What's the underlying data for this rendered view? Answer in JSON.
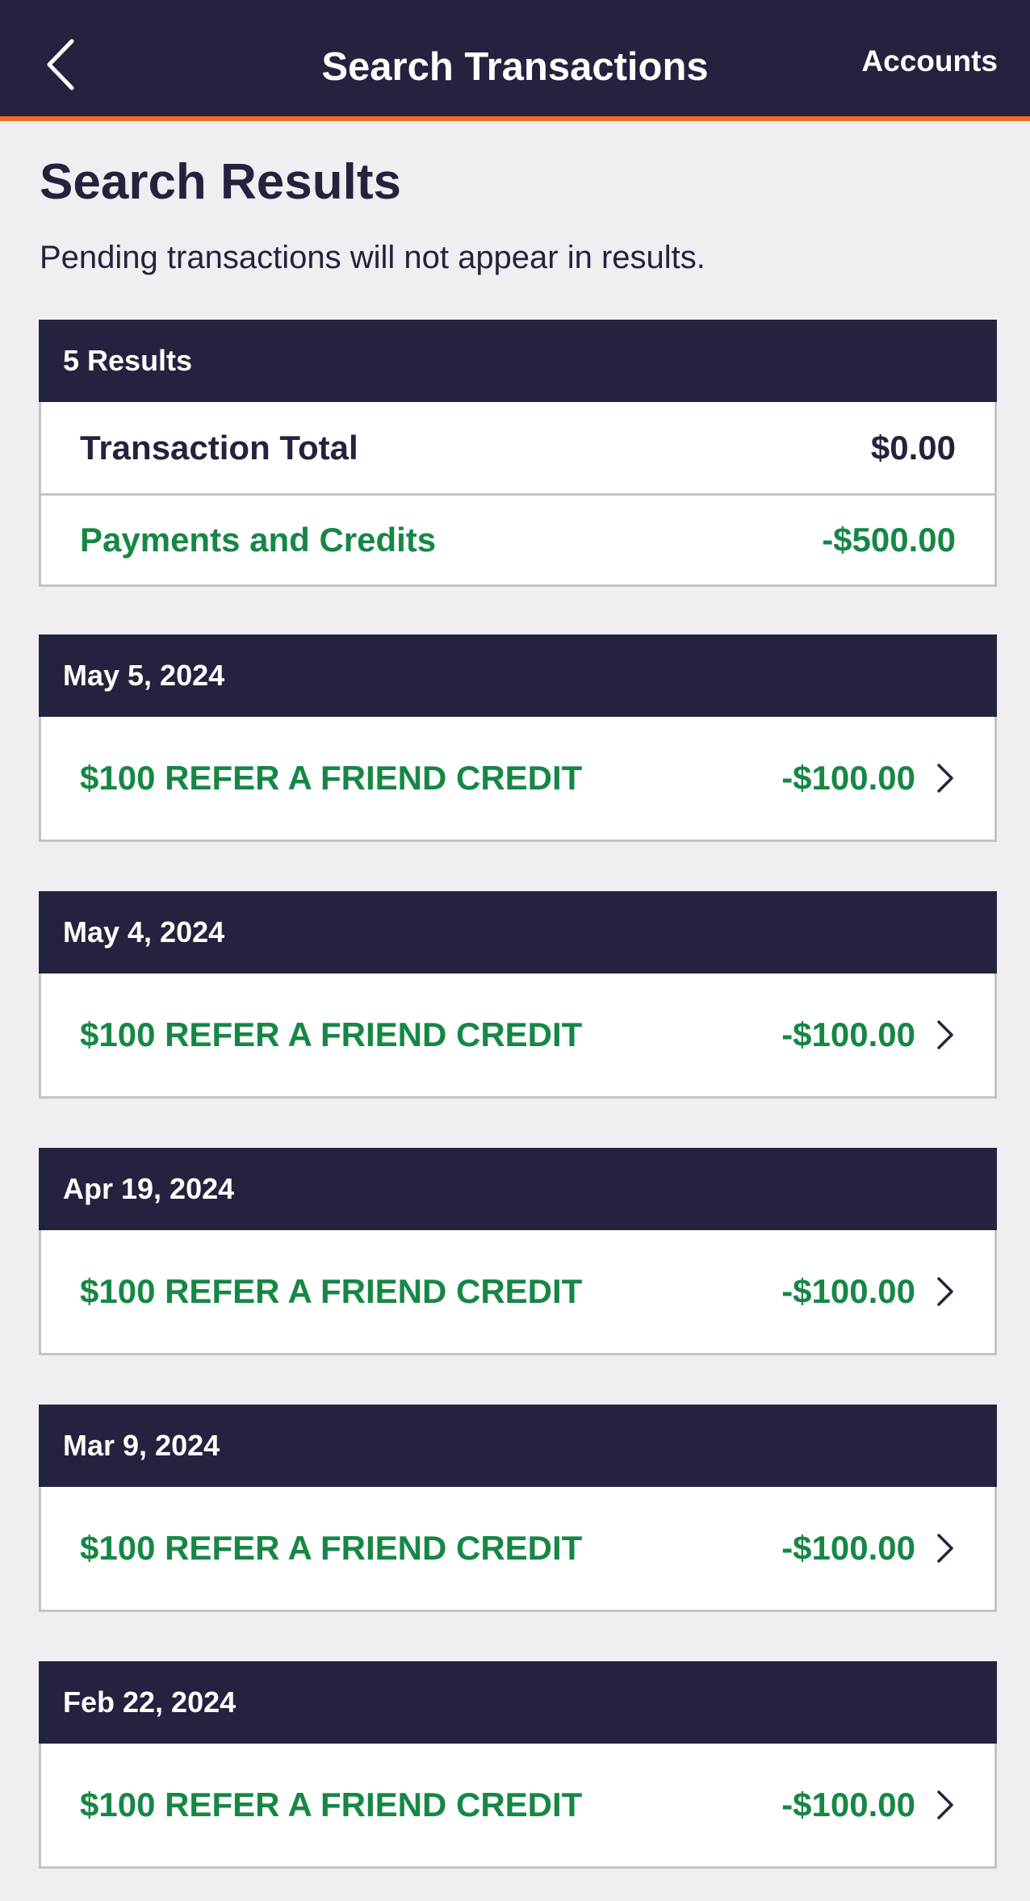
{
  "nav": {
    "title": "Search Transactions",
    "accounts_label": "Accounts",
    "back_icon": "chevron-left-icon",
    "background_color": "#23233f",
    "accent_color": "#f06a2a"
  },
  "page": {
    "heading": "Search Results",
    "notice": "Pending transactions will not appear in results."
  },
  "summary": {
    "results_label": "5 Results",
    "total_label": "Transaction Total",
    "total_value": "$0.00",
    "credits_label": "Payments and Credits",
    "credits_value": "-$500.00"
  },
  "transactions": [
    {
      "date": "May 5, 2024",
      "description": "$100 REFER A FRIEND CREDIT",
      "amount": "-$100.00"
    },
    {
      "date": "May 4, 2024",
      "description": "$100 REFER A FRIEND CREDIT",
      "amount": "-$100.00"
    },
    {
      "date": "Apr 19, 2024",
      "description": "$100 REFER A FRIEND CREDIT",
      "amount": "-$100.00"
    },
    {
      "date": "Mar 9, 2024",
      "description": "$100 REFER A FRIEND CREDIT",
      "amount": "-$100.00"
    },
    {
      "date": "Feb 22, 2024",
      "description": "$100 REFER A FRIEND CREDIT",
      "amount": "-$100.00"
    }
  ],
  "colors": {
    "credit_green": "#168744",
    "page_background": "#efeff1"
  }
}
